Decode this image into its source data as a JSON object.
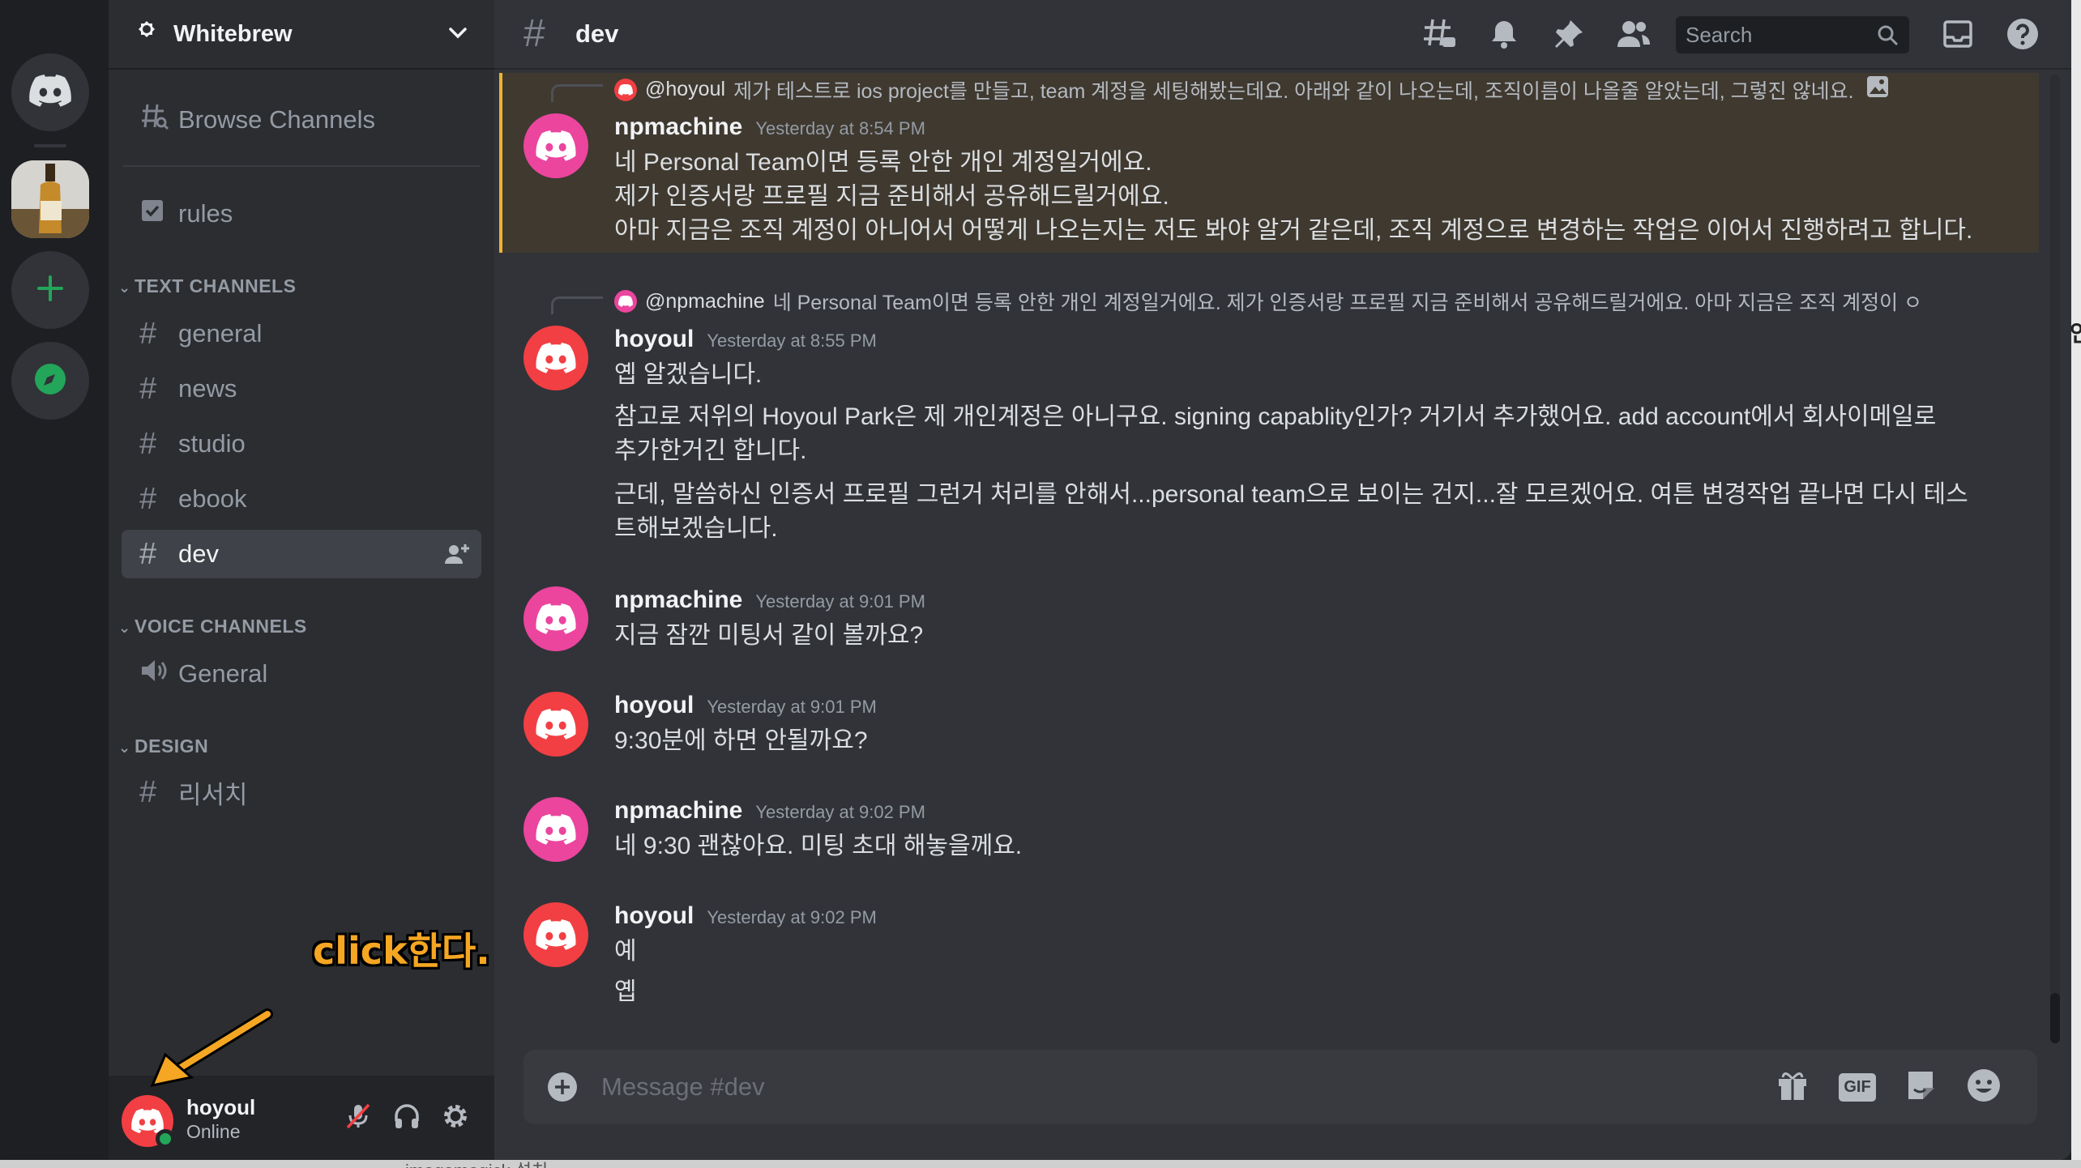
{
  "server": {
    "name": "Whitebrew"
  },
  "sidebar": {
    "browse_label": "Browse Channels",
    "rules_label": "rules",
    "text_category": "TEXT CHANNELS",
    "text_channels": [
      "general",
      "news",
      "studio",
      "ebook",
      "dev"
    ],
    "voice_category": "VOICE CHANNELS",
    "voice_channel": "General",
    "design_category": "DESIGN",
    "design_channel": "리서치"
  },
  "user": {
    "name": "hoyoul",
    "status": "Online"
  },
  "header": {
    "channel": "dev",
    "search_placeholder": "Search"
  },
  "messages": [
    {
      "reply_mention": "@hoyoul",
      "reply_text": "제가 테스트로 ios project를 만들고, team 계정을 세팅해봤는데요. 아래와 같이 나오는데, 조직이름이 나올줄 알았는데, 그렇진 않네요.",
      "author": "npmachine",
      "timestamp": "Yesterday at 8:54 PM",
      "lines": [
        "네 Personal Team이면 등록 안한 개인 계정일거에요.",
        "제가 인증서랑 프로필 지금 준비해서 공유해드릴거에요.",
        "아마 지금은 조직 계정이 아니어서 어떻게 나오는지는 저도 봐야 알거 같은데, 조직 계정으로 변경하는 작업은 이어서 진행하려고 합니다."
      ]
    },
    {
      "reply_mention": "@npmachine",
      "reply_text": "네 Personal Team이면 등록 안한 개인 계정일거에요. 제가 인증서랑 프로필 지금 준비해서 공유해드릴거에요. 아마 지금은 조직 계정이 ㅇ",
      "author": "hoyoul",
      "timestamp": "Yesterday at 8:55 PM",
      "lines": [
        "옙 알겠습니다.",
        "참고로 저위의 Hoyoul Park은 제 개인계정은 아니구요.  signing capablity인가? 거기서 추가했어요. add account에서 회사이메일로",
        "추가한거긴 합니다.",
        "근데, 말씀하신 인증서 프로필 그런거 처리를 안해서...personal team으로 보이는 건지...잘 모르겠어요. 여튼 변경작업 끝나면 다시 테스",
        "트해보겠습니다."
      ]
    },
    {
      "author": "npmachine",
      "timestamp": "Yesterday at 9:01 PM",
      "lines": [
        "지금 잠깐 미팅서 같이 볼까요?"
      ]
    },
    {
      "author": "hoyoul",
      "timestamp": "Yesterday at 9:01 PM",
      "lines": [
        "9:30분에 하면 안될까요?"
      ]
    },
    {
      "author": "npmachine",
      "timestamp": "Yesterday at 9:02 PM",
      "lines": [
        "네 9:30 괜찮아요. 미팅 초대 해놓을께요."
      ]
    },
    {
      "author": "hoyoul",
      "timestamp": "Yesterday at 9:02 PM",
      "lines": [
        "예",
        "옙"
      ]
    }
  ],
  "composer": {
    "placeholder": "Message #dev",
    "gif_label": "GIF"
  },
  "annotation": {
    "text": "click한다."
  },
  "peek": {
    "bottom_text": "imagemagick 설치",
    "right_text": "인"
  },
  "colors": {
    "blurple": "#5865f2",
    "pink": "#eb459e",
    "red": "#f23f43",
    "online": "#23a55a",
    "mention_highlight": "#f0b232",
    "annotation": "#f5a623"
  },
  "icons": [
    "gear-icon",
    "chevron-down-icon",
    "browse-channels-icon",
    "rules-icon",
    "hash-icon",
    "add-member-icon",
    "speaker-icon",
    "threads-icon",
    "bell-icon",
    "pin-icon",
    "members-icon",
    "search-icon",
    "inbox-icon",
    "help-icon",
    "plus-circle-icon",
    "gift-icon",
    "sticker-icon",
    "emoji-icon",
    "mute-mic-icon",
    "headphones-icon",
    "settings-icon",
    "discord-icon",
    "explore-icon"
  ]
}
